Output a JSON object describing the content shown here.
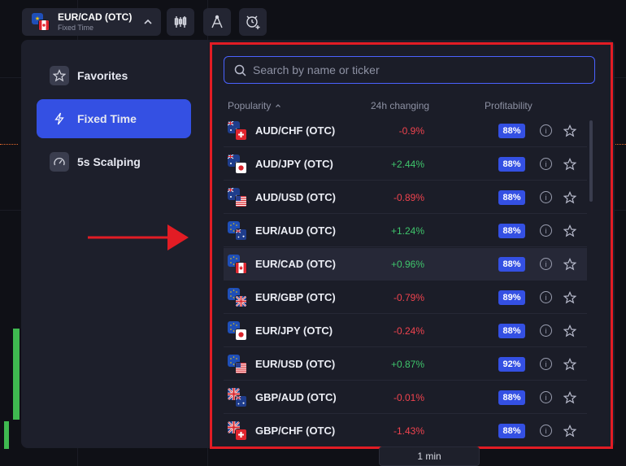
{
  "header": {
    "pair_name": "EUR/CAD (OTC)",
    "pair_mode": "Fixed Time",
    "chevron_icon": "chevron-up-icon",
    "tools": [
      "candlestick-chart-icon",
      "drawing-tools-icon",
      "add-alert-icon"
    ]
  },
  "sidebar": {
    "items": [
      {
        "label": "Favorites",
        "icon": "star-icon",
        "active": false
      },
      {
        "label": "Fixed Time",
        "icon": "lightning-icon",
        "active": true
      },
      {
        "label": "5s Scalping",
        "icon": "speedometer-icon",
        "active": false
      }
    ]
  },
  "search": {
    "placeholder": "Search by name or ticker",
    "value": ""
  },
  "columns": {
    "popularity": "Popularity",
    "sort_icon": "caret-up-icon",
    "change": "24h changing",
    "profit": "Profitability"
  },
  "assets": [
    {
      "name": "AUD/CHF (OTC)",
      "change": "-0.9%",
      "dir": "down",
      "profit": "88%",
      "base": "aud",
      "quote": "chf"
    },
    {
      "name": "AUD/JPY (OTC)",
      "change": "+2.44%",
      "dir": "up",
      "profit": "88%",
      "base": "aud",
      "quote": "jpy"
    },
    {
      "name": "AUD/USD (OTC)",
      "change": "-0.89%",
      "dir": "down",
      "profit": "88%",
      "base": "aud",
      "quote": "usd"
    },
    {
      "name": "EUR/AUD (OTC)",
      "change": "+1.24%",
      "dir": "up",
      "profit": "88%",
      "base": "eur",
      "quote": "aud"
    },
    {
      "name": "EUR/CAD (OTC)",
      "change": "+0.96%",
      "dir": "up",
      "profit": "88%",
      "base": "eur",
      "quote": "cad",
      "selected": true
    },
    {
      "name": "EUR/GBP (OTC)",
      "change": "-0.79%",
      "dir": "down",
      "profit": "89%",
      "base": "eur",
      "quote": "gbp"
    },
    {
      "name": "EUR/JPY (OTC)",
      "change": "-0.24%",
      "dir": "down",
      "profit": "88%",
      "base": "eur",
      "quote": "jpy"
    },
    {
      "name": "EUR/USD (OTC)",
      "change": "+0.87%",
      "dir": "up",
      "profit": "92%",
      "base": "eur",
      "quote": "usd"
    },
    {
      "name": "GBP/AUD (OTC)",
      "change": "-0.01%",
      "dir": "down",
      "profit": "88%",
      "base": "gbp",
      "quote": "aud"
    },
    {
      "name": "GBP/CHF (OTC)",
      "change": "-1.43%",
      "dir": "down",
      "profit": "88%",
      "base": "gbp",
      "quote": "chf"
    }
  ],
  "row_icons": {
    "info": "info-icon",
    "favorite": "star-outline-icon"
  },
  "footer": {
    "timeframe": "1 min"
  },
  "colors": {
    "accent": "#3450e3",
    "positive": "#3fc46b",
    "negative": "#f0434e",
    "annotation": "#e21c24",
    "panel": "#1d1f2b"
  }
}
